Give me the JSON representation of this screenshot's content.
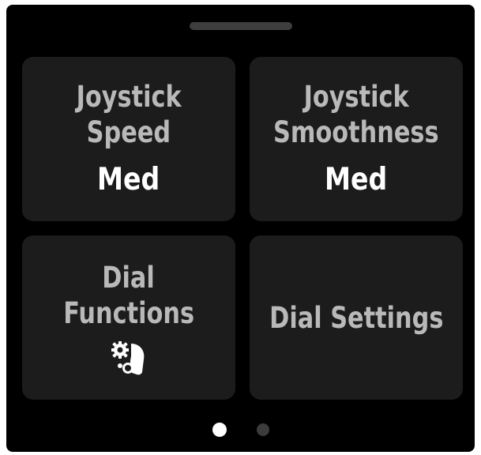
{
  "colors": {
    "background": "#000000",
    "tile": "#1c1c1c",
    "label_text": "#b9b9b9",
    "value_text": "#ffffff",
    "dot_active": "#ffffff",
    "dot_inactive": "#3c3c3c"
  },
  "tiles": [
    {
      "title_line1": "Joystick",
      "title_line2": "Speed",
      "value": "Med"
    },
    {
      "title_line1": "Joystick",
      "title_line2": "Smoothness",
      "value": "Med"
    },
    {
      "title_line1": "Dial",
      "title_line2": "Functions",
      "icon": "dial-functions-icon"
    },
    {
      "title": "Dial Settings"
    }
  ],
  "pagination": {
    "pages": 2,
    "current": 1
  }
}
